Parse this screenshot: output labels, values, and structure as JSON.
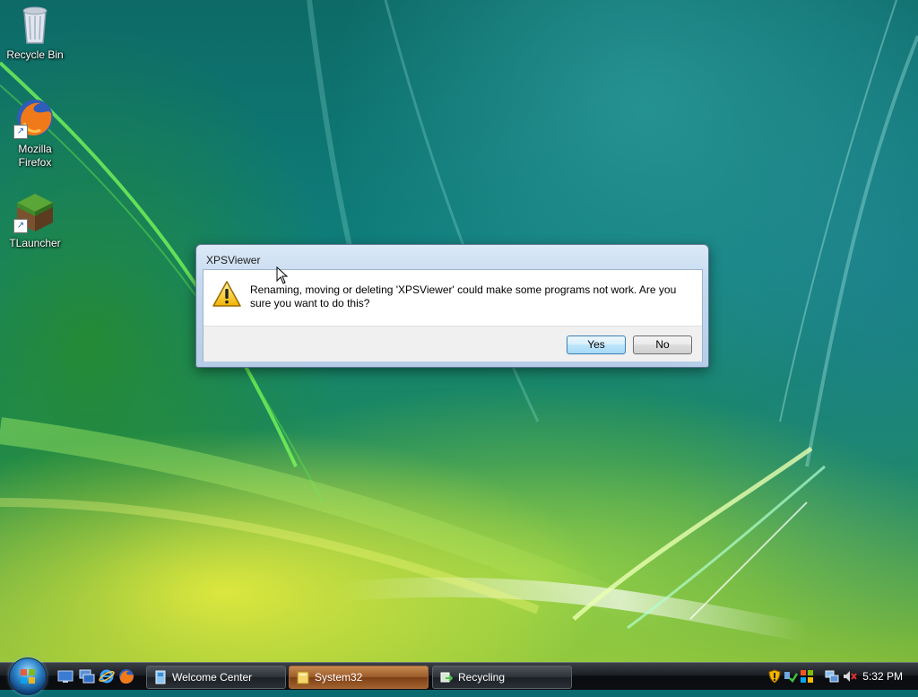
{
  "desktop": {
    "icons": [
      {
        "label": "Recycle Bin",
        "icon": "recycle-bin-icon"
      },
      {
        "label": "Mozilla\nFirefox",
        "icon": "firefox-icon"
      },
      {
        "label": "TLauncher",
        "icon": "tlauncher-icon"
      }
    ]
  },
  "dialog": {
    "title": "XPSViewer",
    "message": "Renaming, moving or deleting 'XPSViewer' could make some programs not work. Are you sure you want to do this?",
    "icon": "warning-icon",
    "buttons": {
      "yes": "Yes",
      "no": "No"
    }
  },
  "taskbar": {
    "quick_launch": [
      "show-desktop-icon",
      "switch-windows-icon",
      "internet-explorer-icon",
      "firefox-icon"
    ],
    "tasks": [
      {
        "label": "Welcome Center",
        "icon": "welcome-center-icon",
        "active": false
      },
      {
        "label": "System32",
        "icon": "folder-icon",
        "active": true
      },
      {
        "label": "Recycling",
        "icon": "file-move-icon",
        "active": false
      }
    ],
    "tray": {
      "icons": [
        "security-shield-icon",
        "network-check-icon",
        "windows-defender-icon",
        "network-icon",
        "volume-muted-icon"
      ],
      "clock": "5:32 PM"
    }
  },
  "colors": {
    "dialog_frame": "#c6daf0",
    "default_button": "#bee6fd",
    "active_task": "#9a5a2a",
    "taskbar": "#1c1f24"
  }
}
